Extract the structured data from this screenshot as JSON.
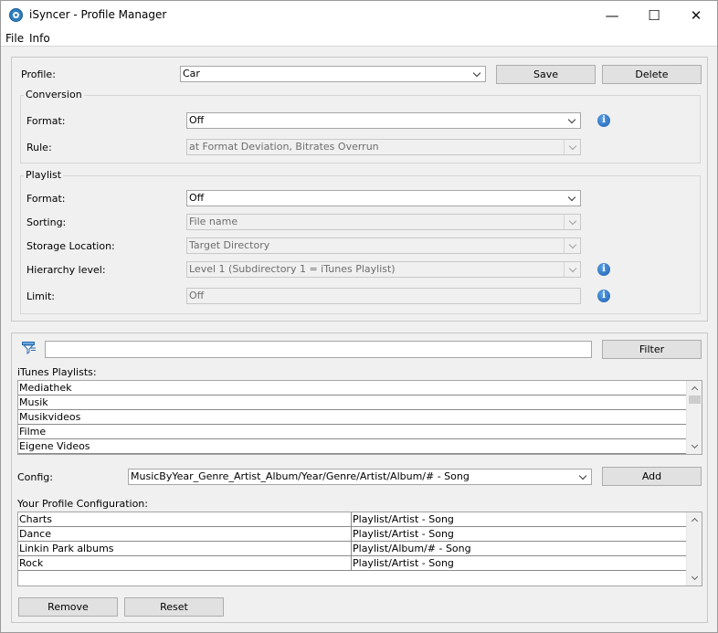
{
  "window": {
    "title": "iSyncer - Profile Manager",
    "minimize": "—",
    "maximize": "☐",
    "close": "✕"
  },
  "menu": [
    "File",
    "Info"
  ],
  "profile": {
    "label": "Profile:",
    "value": "Car",
    "save": "Save",
    "delete": "Delete"
  },
  "conversion": {
    "title": "Conversion",
    "format_label": "Format:",
    "format_value": "Off",
    "rule_label": "Rule:",
    "rule_value": "at Format Deviation, Bitrates Overrun"
  },
  "playlist": {
    "title": "Playlist",
    "format_label": "Format:",
    "format_value": "Off",
    "sorting_label": "Sorting:",
    "sorting_value": "File name",
    "storage_label": "Storage Location:",
    "storage_value": "Target Directory",
    "hierarchy_label": "Hierarchy level:",
    "hierarchy_value": "Level 1 (Subdirectory 1 = iTunes Playlist)",
    "limit_label": "Limit:",
    "limit_value": "Off"
  },
  "filter": {
    "value": "",
    "button": "Filter"
  },
  "itunes": {
    "label": "iTunes Playlists:",
    "items": [
      "Mediathek",
      "Musik",
      "Musikvideos",
      "Filme",
      "Eigene Videos"
    ]
  },
  "config": {
    "label": "Config:",
    "value": "MusicByYear_Genre_Artist_Album/Year/Genre/Artist/Album/# - Song",
    "add": "Add"
  },
  "your_config": {
    "label": "Your Profile Configuration:",
    "rows": [
      {
        "name": "Charts",
        "pattern": "Playlist/Artist - Song"
      },
      {
        "name": "Dance",
        "pattern": "Playlist/Artist - Song"
      },
      {
        "name": "Linkin Park albums",
        "pattern": "Playlist/Album/# - Song"
      },
      {
        "name": "Rock",
        "pattern": "Playlist/Artist - Song"
      }
    ]
  },
  "actions": {
    "remove": "Remove",
    "reset": "Reset"
  },
  "colors": {
    "info_icon": "#1d5fb0",
    "window_bg": "#f0f0f0"
  }
}
